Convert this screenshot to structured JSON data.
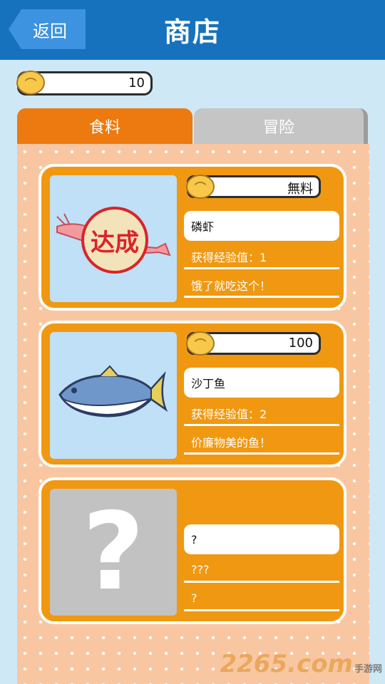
{
  "header": {
    "back_label": "返回",
    "title": "商店"
  },
  "wallet": {
    "amount": "10"
  },
  "tabs": [
    {
      "label": "食料",
      "active": true
    },
    {
      "label": "冒险",
      "active": false
    }
  ],
  "items": [
    {
      "price": "無料",
      "name": "磷虾",
      "exp": "获得经验值：1",
      "desc": "饿了就吃这个！",
      "stamp": "达成",
      "image": "shrimp-icon"
    },
    {
      "price": "100",
      "name": "沙丁鱼",
      "exp": "获得经验值：2",
      "desc": "价廉物美的鱼！",
      "image": "sardine-icon"
    },
    {
      "price": "",
      "name": "?",
      "exp": "???",
      "desc": "?",
      "image": "question-mark-icon"
    }
  ],
  "watermark": {
    "number": "2265",
    "suffix": ".com",
    "site": "手游网"
  },
  "colors": {
    "header": "#1672bd",
    "accent_orange": "#f09811",
    "tab_active": "#ec7a10",
    "tab_inactive": "#c5c5c5"
  }
}
